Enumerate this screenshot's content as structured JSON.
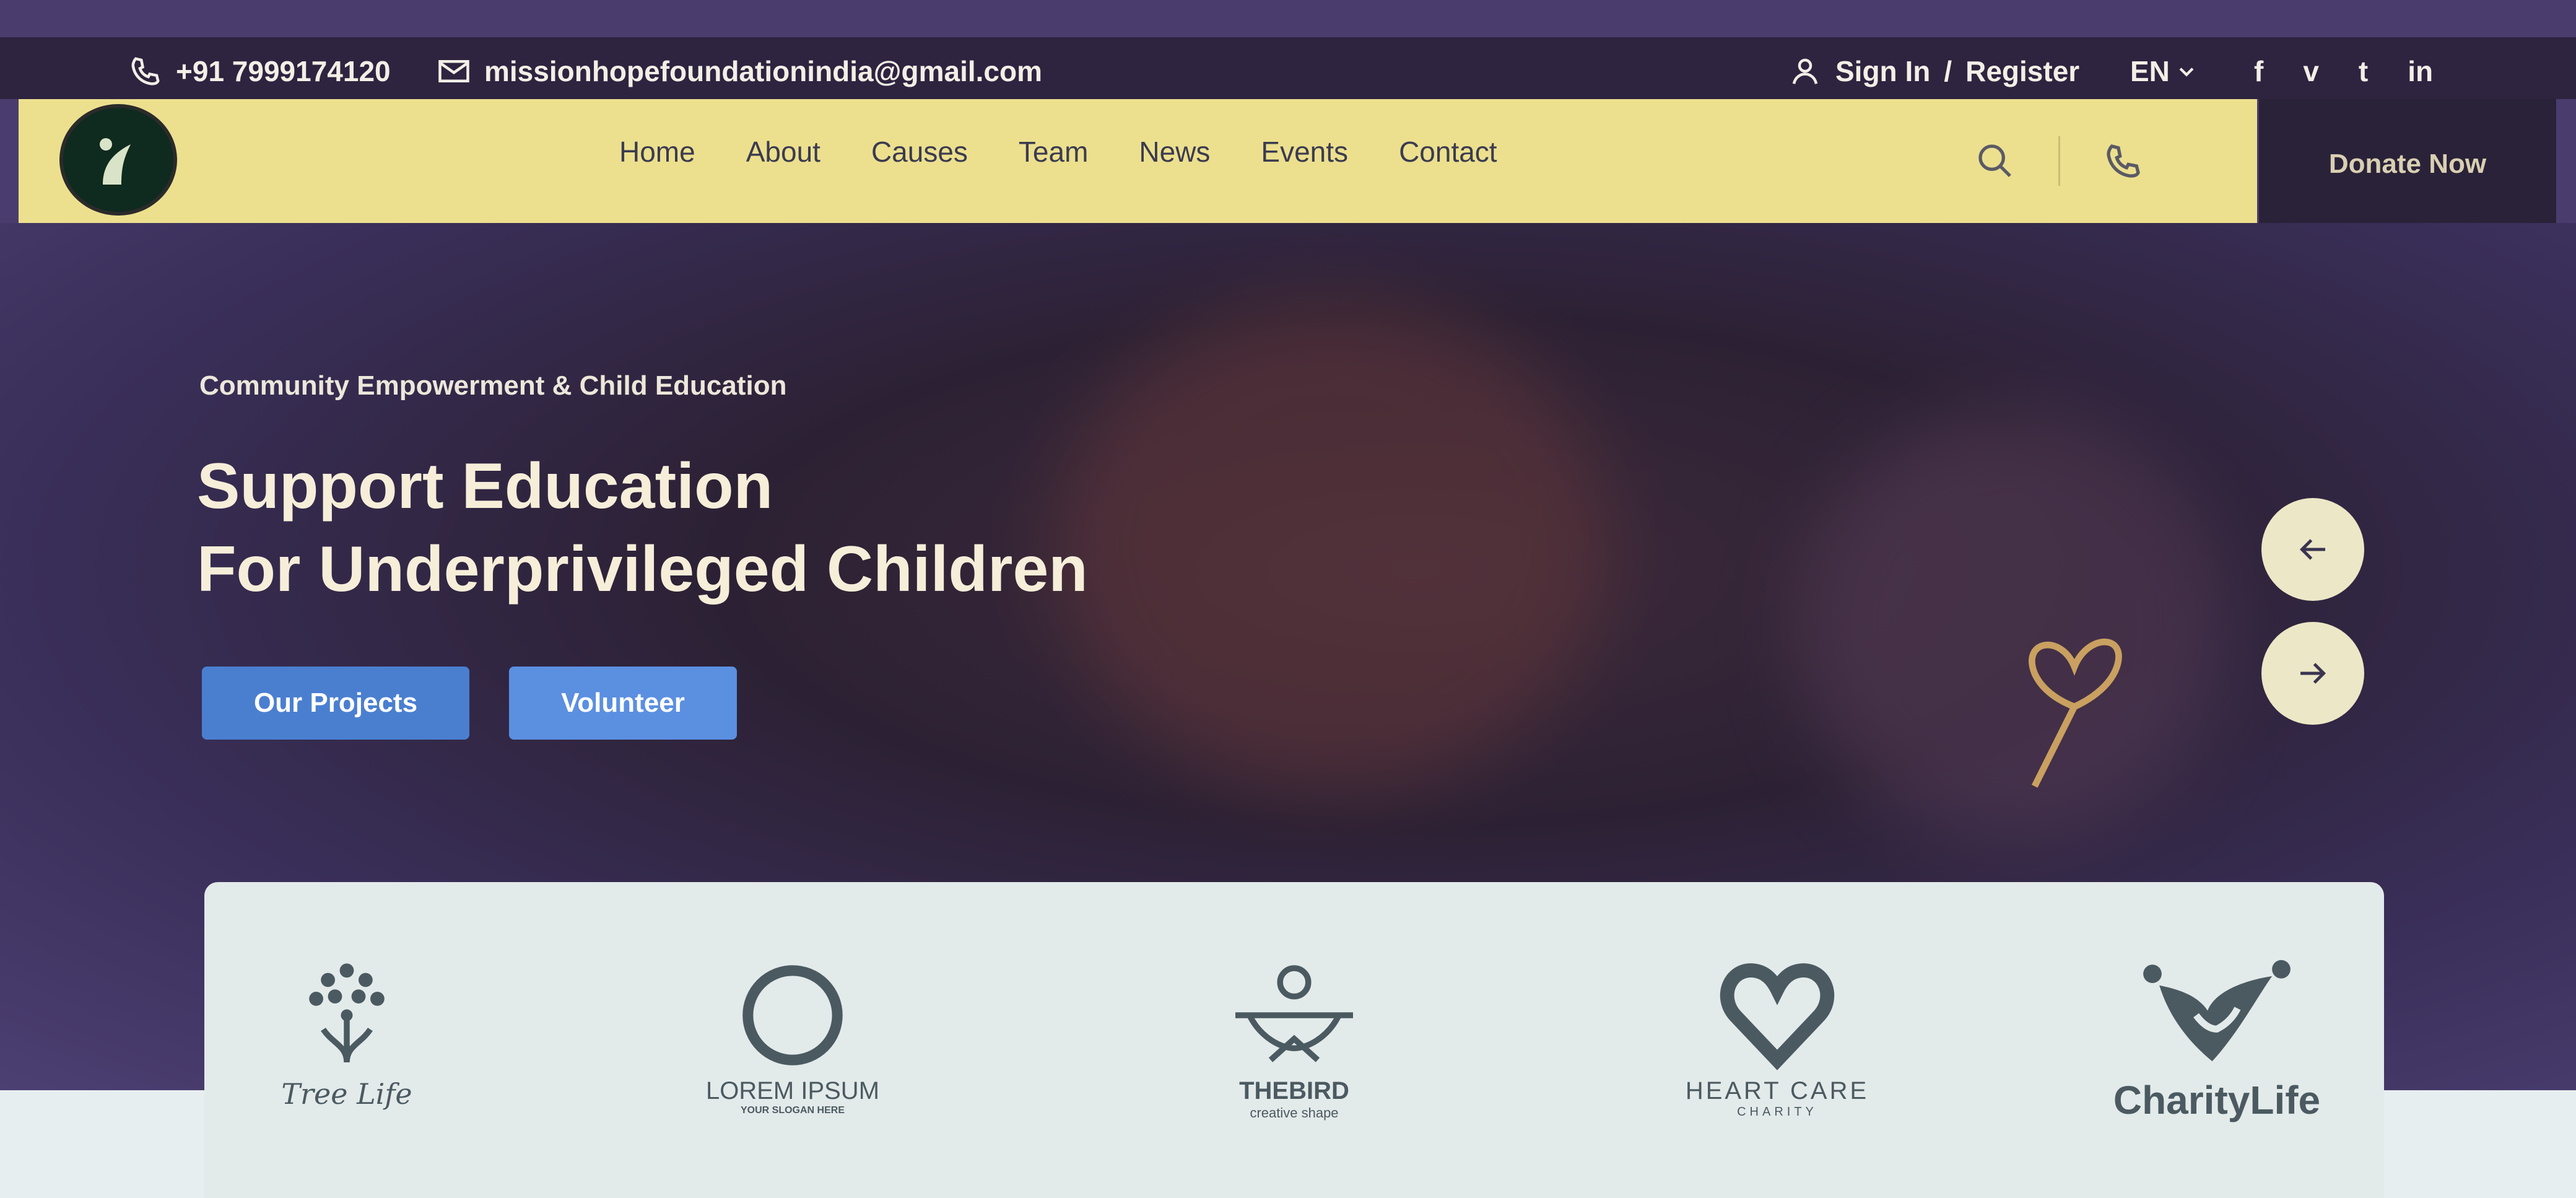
{
  "topbar": {
    "phone": "+91 7999174120",
    "email": "missionhopefoundationindia@gmail.com",
    "sign_in": "Sign In",
    "separator": "/",
    "register": "Register",
    "language": "EN",
    "social": [
      "facebook-icon",
      "vimeo-icon",
      "twitter-icon",
      "linkedin-icon"
    ],
    "social_labels": [
      "f",
      "v",
      "t",
      "in"
    ]
  },
  "nav": {
    "items": [
      "Home",
      "About",
      "Causes",
      "Team",
      "News",
      "Events",
      "Contact"
    ],
    "donate": "Donate Now",
    "background": "#ece08e"
  },
  "hero": {
    "eyebrow": "Community Empowerment & Child Education",
    "title_line1": "Support Education",
    "title_line2": "For Underprivileged Children",
    "buttons": [
      "Our Projects",
      "Volunteer"
    ],
    "button_colors": [
      "#4a7fd0",
      "#5b8fe0"
    ]
  },
  "partners": [
    {
      "name": "Tree Life",
      "sub": ""
    },
    {
      "name": "LOREM IPSUM",
      "sub": "YOUR SLOGAN HERE"
    },
    {
      "name": "THEBIRD",
      "sub": "creative shape"
    },
    {
      "name": "HEART CARE",
      "sub": "CHARITY"
    },
    {
      "name": "CharityLife",
      "sub": ""
    }
  ]
}
